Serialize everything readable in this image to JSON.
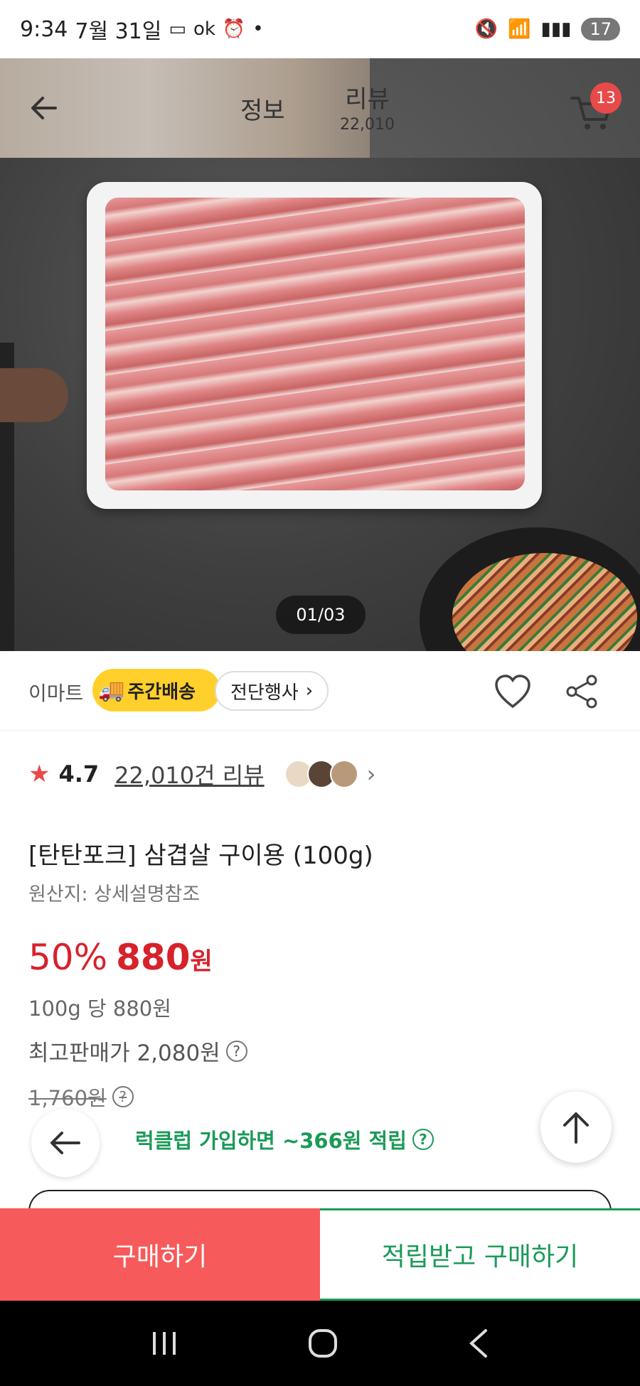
{
  "status_bar": {
    "time": "9:34",
    "date": "7월 31일",
    "left_icons": [
      "nb-badge",
      "ok-badge",
      "alarm-icon",
      "dot"
    ],
    "battery": "17"
  },
  "header": {
    "tabs": [
      {
        "label": "정보"
      },
      {
        "label": "리뷰",
        "count": "22,010"
      }
    ],
    "cart_count": "13"
  },
  "gallery": {
    "pager": "01/03"
  },
  "seller_row": {
    "seller": "이마트",
    "delivery_badge": "주간배송",
    "store_link": "전단행사"
  },
  "product": {
    "rating": "4.7",
    "review_count": "22,010건 리뷰",
    "title": "[탄탄포크] 삼겹살 구이용 (100g)",
    "origin": "원산지: 상세설명참조",
    "discount": "50%",
    "price": "880",
    "currency": "원",
    "unit_price": "100g 당 880원",
    "max_price": "최고판매가 2,080원",
    "original_price": "1,760원",
    "reward": "럭클럽 가입하면 ~366원 적립"
  },
  "actions": {
    "buy": "구매하기",
    "buy_with_reward": "적립받고 구매하기"
  },
  "colors": {
    "accent_red": "#d7212b",
    "buy_button": "#f65a5a",
    "reward_green": "#1b9a58",
    "badge_yellow": "#ffd02b"
  }
}
